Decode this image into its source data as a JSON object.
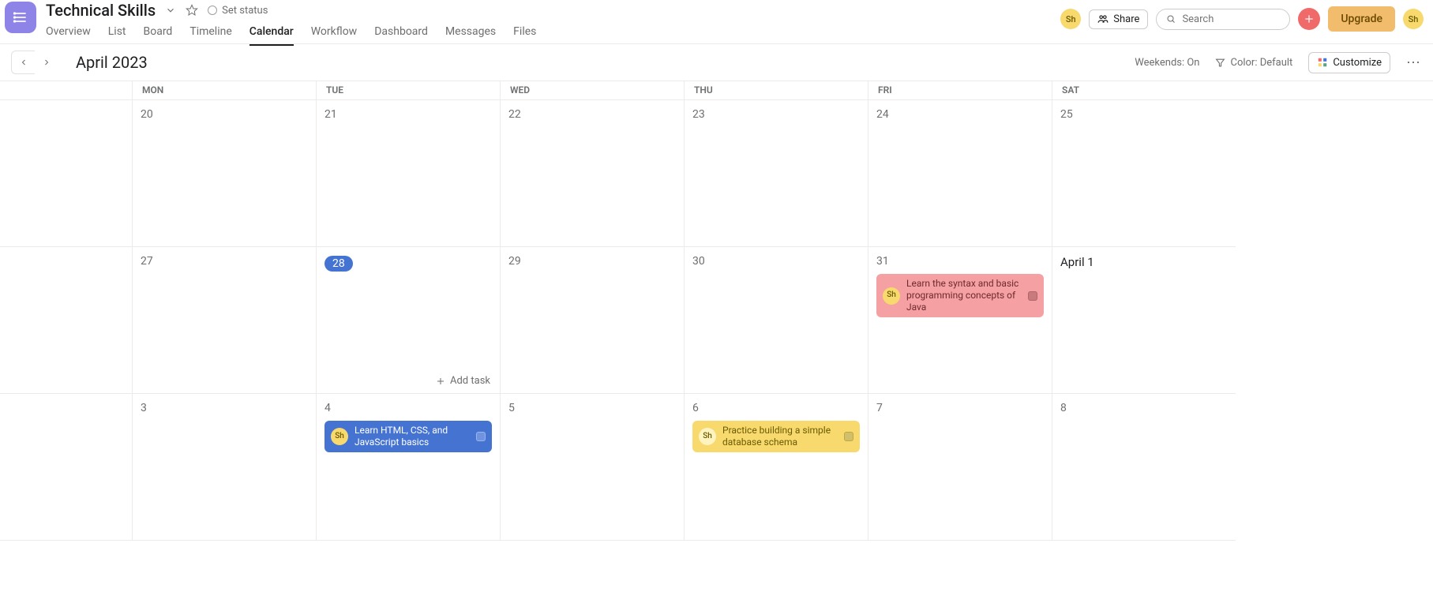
{
  "header": {
    "title": "Technical Skills",
    "set_status": "Set status",
    "share": "Share",
    "search_placeholder": "Search",
    "upgrade": "Upgrade",
    "avatar_initials": "Sh"
  },
  "tabs": {
    "items": [
      {
        "label": "Overview"
      },
      {
        "label": "List"
      },
      {
        "label": "Board"
      },
      {
        "label": "Timeline"
      },
      {
        "label": "Calendar",
        "active": true
      },
      {
        "label": "Workflow"
      },
      {
        "label": "Dashboard"
      },
      {
        "label": "Messages"
      },
      {
        "label": "Files"
      }
    ]
  },
  "toolbar": {
    "month_label": "April 2023",
    "weekends": "Weekends: On",
    "color": "Color: Default",
    "customize": "Customize",
    "add_task": "Add task"
  },
  "week_headers": [
    "MON",
    "TUE",
    "WED",
    "THU",
    "FRI",
    "SAT"
  ],
  "rows": [
    {
      "days": [
        {
          "num": "20"
        },
        {
          "num": "21"
        },
        {
          "num": "22"
        },
        {
          "num": "23"
        },
        {
          "num": "24"
        },
        {
          "num": "25"
        }
      ]
    },
    {
      "days": [
        {
          "num": "27"
        },
        {
          "num": "28",
          "today": true,
          "show_add": true
        },
        {
          "num": "29"
        },
        {
          "num": "30"
        },
        {
          "num": "31",
          "tasks": [
            {
              "color": "pink",
              "assignee": "Sh",
              "title": "Learn the syntax and basic programming concepts of Java"
            }
          ]
        },
        {
          "num": "April 1",
          "month_start": true
        }
      ]
    },
    {
      "days": [
        {
          "num": "3"
        },
        {
          "num": "4",
          "tasks": [
            {
              "color": "blue",
              "assignee": "Sh",
              "title": "Learn HTML, CSS, and JavaScript basics"
            }
          ]
        },
        {
          "num": "5"
        },
        {
          "num": "6",
          "tasks": [
            {
              "color": "yellow",
              "assignee": "Sh",
              "title": "Practice building a simple database schema"
            }
          ]
        },
        {
          "num": "7"
        },
        {
          "num": "8"
        }
      ]
    }
  ]
}
